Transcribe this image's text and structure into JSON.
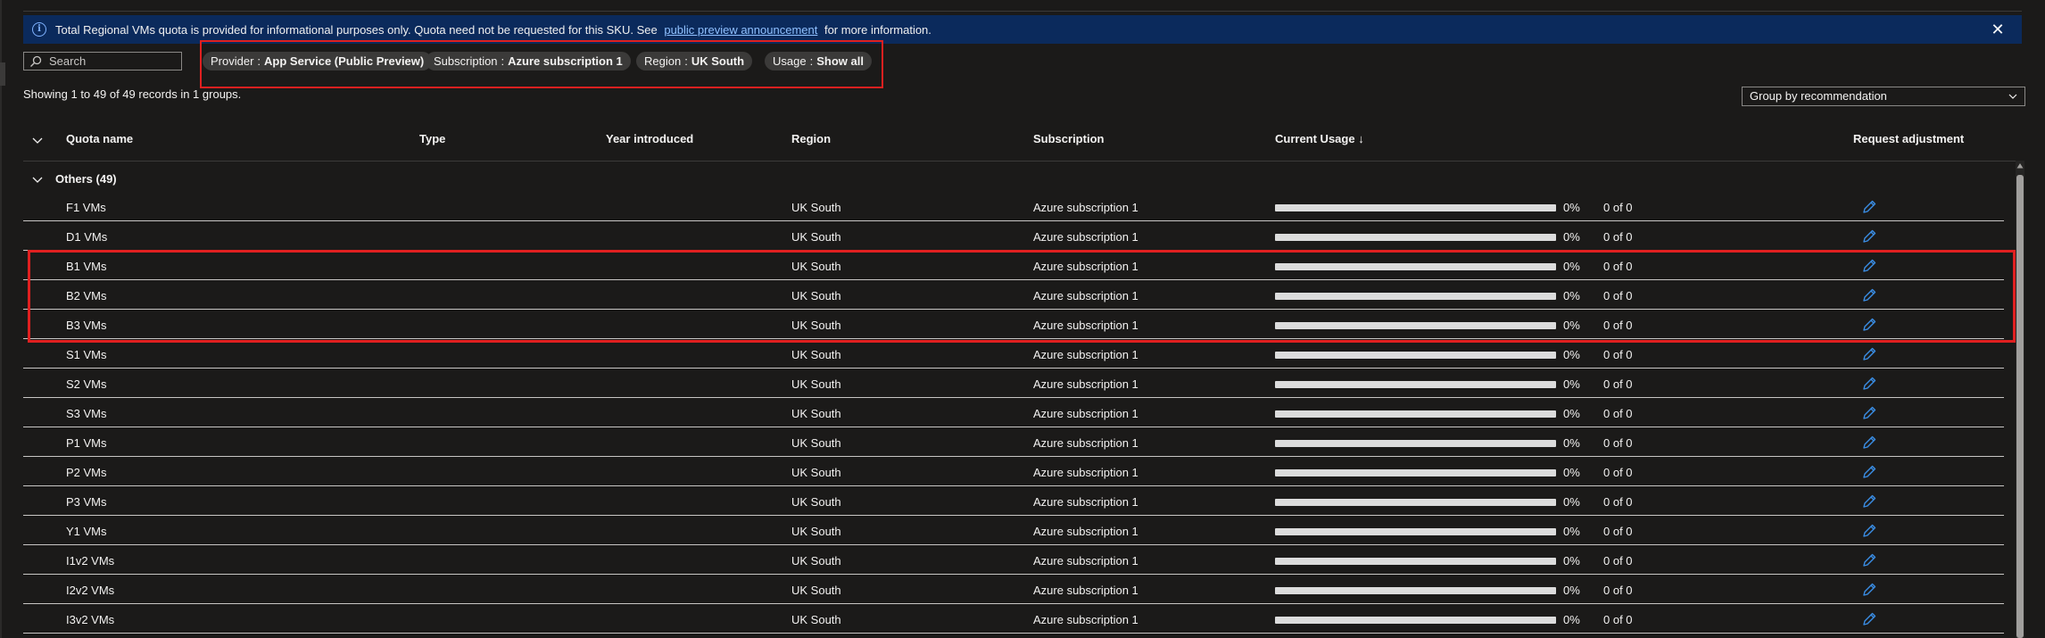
{
  "banner": {
    "text_before": "Total Regional VMs quota is provided for informational purposes only. Quota need not be requested for this SKU. See",
    "link_text": "public preview announcement",
    "text_after": "for more information."
  },
  "search": {
    "placeholder": "Search"
  },
  "filters": [
    {
      "key": "Provider",
      "sep": ":",
      "value": "App Service (Public Preview)"
    },
    {
      "key": "Subscription",
      "sep": ":",
      "value": "Azure subscription 1"
    },
    {
      "key": "Region",
      "sep": ":",
      "value": "UK South"
    },
    {
      "key": "Usage",
      "sep": ":",
      "value": "Show all"
    }
  ],
  "records_text": "Showing 1 to 49 of 49 records in 1 groups.",
  "group_by": {
    "selected": "Group by recommendation"
  },
  "columns": {
    "name": "Quota name",
    "type": "Type",
    "year": "Year introduced",
    "region": "Region",
    "subscription": "Subscription",
    "usage": "Current Usage ↓",
    "adjust": "Request adjustment"
  },
  "group": {
    "label": "Others (49)"
  },
  "rows": [
    {
      "name": "F1 VMs",
      "region": "UK South",
      "subscription": "Azure subscription 1",
      "pct": "0%",
      "usage_fraction": 0,
      "of": "0 of 0"
    },
    {
      "name": "D1 VMs",
      "region": "UK South",
      "subscription": "Azure subscription 1",
      "pct": "0%",
      "usage_fraction": 0,
      "of": "0 of 0"
    },
    {
      "name": "B1 VMs",
      "region": "UK South",
      "subscription": "Azure subscription 1",
      "pct": "0%",
      "usage_fraction": 0,
      "of": "0 of 0"
    },
    {
      "name": "B2 VMs",
      "region": "UK South",
      "subscription": "Azure subscription 1",
      "pct": "0%",
      "usage_fraction": 0,
      "of": "0 of 0"
    },
    {
      "name": "B3 VMs",
      "region": "UK South",
      "subscription": "Azure subscription 1",
      "pct": "0%",
      "usage_fraction": 0,
      "of": "0 of 0"
    },
    {
      "name": "S1 VMs",
      "region": "UK South",
      "subscription": "Azure subscription 1",
      "pct": "0%",
      "usage_fraction": 0,
      "of": "0 of 0"
    },
    {
      "name": "S2 VMs",
      "region": "UK South",
      "subscription": "Azure subscription 1",
      "pct": "0%",
      "usage_fraction": 0,
      "of": "0 of 0"
    },
    {
      "name": "S3 VMs",
      "region": "UK South",
      "subscription": "Azure subscription 1",
      "pct": "0%",
      "usage_fraction": 0,
      "of": "0 of 0"
    },
    {
      "name": "P1 VMs",
      "region": "UK South",
      "subscription": "Azure subscription 1",
      "pct": "0%",
      "usage_fraction": 0,
      "of": "0 of 0"
    },
    {
      "name": "P2 VMs",
      "region": "UK South",
      "subscription": "Azure subscription 1",
      "pct": "0%",
      "usage_fraction": 0,
      "of": "0 of 0"
    },
    {
      "name": "P3 VMs",
      "region": "UK South",
      "subscription": "Azure subscription 1",
      "pct": "0%",
      "usage_fraction": 0,
      "of": "0 of 0"
    },
    {
      "name": "Y1 VMs",
      "region": "UK South",
      "subscription": "Azure subscription 1",
      "pct": "0%",
      "usage_fraction": 0,
      "of": "0 of 0"
    },
    {
      "name": "I1v2 VMs",
      "region": "UK South",
      "subscription": "Azure subscription 1",
      "pct": "0%",
      "usage_fraction": 0,
      "of": "0 of 0"
    },
    {
      "name": "I2v2 VMs",
      "region": "UK South",
      "subscription": "Azure subscription 1",
      "pct": "0%",
      "usage_fraction": 0,
      "of": "0 of 0"
    },
    {
      "name": "I3v2 VMs",
      "region": "UK South",
      "subscription": "Azure subscription 1",
      "pct": "0%",
      "usage_fraction": 0,
      "of": "0 of 0"
    }
  ],
  "icons": {
    "banner": "info-icon",
    "close": "close-icon",
    "search": "search-icon",
    "dropdown": "chevron-down-icon",
    "edit": "pencil-edit-icon"
  },
  "colors": {
    "banner_bg": "#0b2a5c",
    "highlight": "#e02020",
    "edit_icon": "#3a8ee6",
    "link": "#8fc0ff"
  }
}
